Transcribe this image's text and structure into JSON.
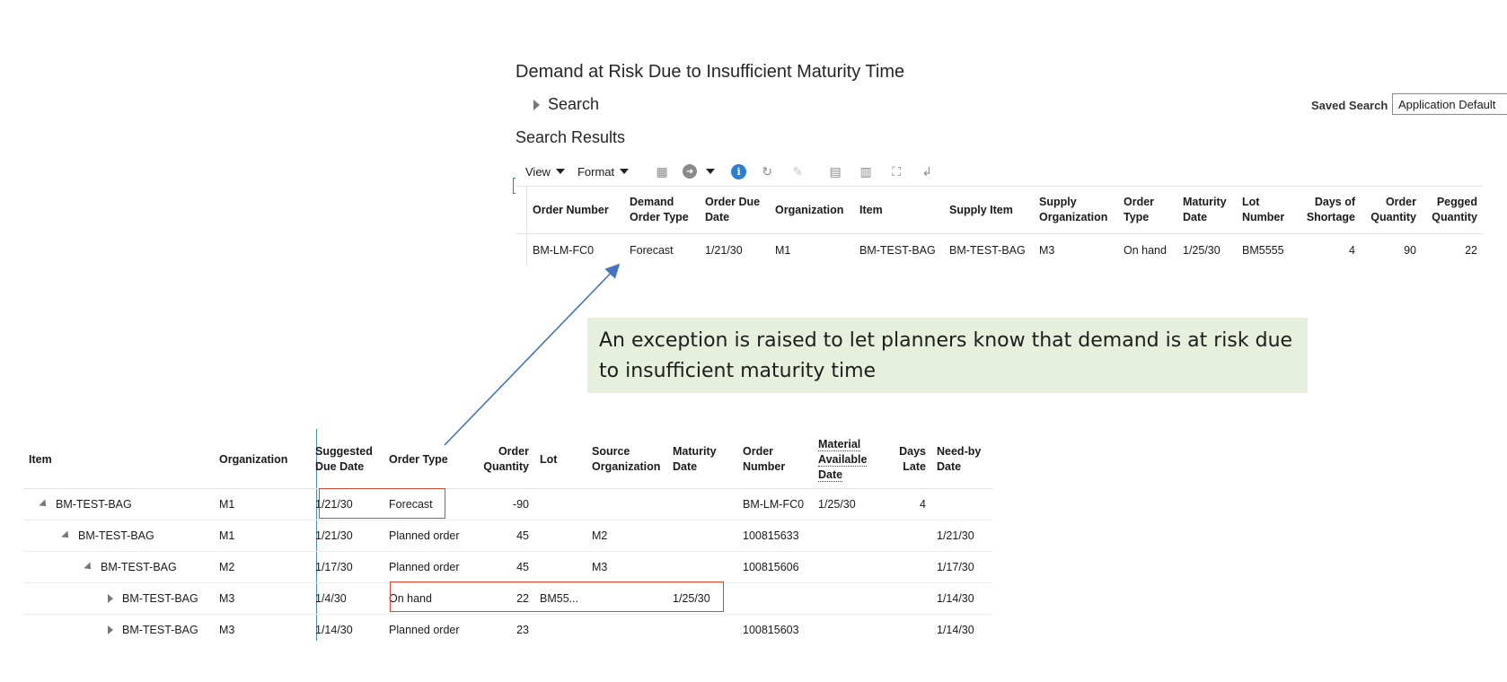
{
  "page": {
    "title": "Demand at Risk Due to Insufficient Maturity Time",
    "search_label": "Search",
    "saved_search_label": "Saved Search",
    "saved_search_value": "Application Default",
    "results_title": "Search Results"
  },
  "toolbar": {
    "view_label": "View",
    "format_label": "Format"
  },
  "results": {
    "headers": {
      "order_number": "Order Number",
      "demand_order_type_1": "Demand",
      "demand_order_type_2": "Order Type",
      "order_due_date_1": "Order Due",
      "order_due_date_2": "Date",
      "organization": "Organization",
      "item": "Item",
      "supply_item": "Supply Item",
      "supply_org_1": "Supply",
      "supply_org_2": "Organization",
      "order_type_1": "Order",
      "order_type_2": "Type",
      "maturity_date_1": "Maturity",
      "maturity_date_2": "Date",
      "lot_number_1": "Lot",
      "lot_number_2": "Number",
      "days_shortage_1": "Days of",
      "days_shortage_2": "Shortage",
      "order_qty_1": "Order",
      "order_qty_2": "Quantity",
      "pegged_qty_1": "Pegged",
      "pegged_qty_2": "Quantity"
    },
    "row": {
      "order_number": "BM-LM-FC0",
      "demand_order_type": "Forecast",
      "order_due_date": "1/21/30",
      "organization": "M1",
      "item": "BM-TEST-BAG",
      "supply_item": "BM-TEST-BAG",
      "supply_organization": "M3",
      "order_type": "On hand",
      "maturity_date": "1/25/30",
      "lot_number": "BM5555",
      "days_of_shortage": "4",
      "order_quantity": "90",
      "pegged_quantity": "22"
    }
  },
  "callout": {
    "text": "An exception is raised to let planners know that demand is at risk due to insufficient maturity time"
  },
  "plan": {
    "headers": {
      "item": "Item",
      "organization": "Organization",
      "suggested_due_1": "Suggested",
      "suggested_due_2": "Due Date",
      "order_type": "Order Type",
      "order_qty_1": "Order",
      "order_qty_2": "Quantity",
      "lot": "Lot",
      "source_org_1": "Source",
      "source_org_2": "Organization",
      "maturity_1": "Maturity",
      "maturity_2": "Date",
      "order_number_1": "Order",
      "order_number_2": "Number",
      "material_available_1": "Material",
      "material_available_2": "Available",
      "material_available_3": "Date",
      "days_late_1": "Days",
      "days_late_2": "Late",
      "need_by_1": "Need-by",
      "need_by_2": "Date"
    },
    "rows": [
      {
        "item": "BM-TEST-BAG",
        "organization": "M1",
        "suggested_due_date": "1/21/30",
        "order_type": "Forecast",
        "order_quantity": "-90",
        "lot": "",
        "source_organization": "",
        "maturity_date": "",
        "order_number": "BM-LM-FC0",
        "material_available_date": "1/25/30",
        "days_late": "4",
        "need_by_date": ""
      },
      {
        "item": "BM-TEST-BAG",
        "organization": "M1",
        "suggested_due_date": "1/21/30",
        "order_type": "Planned order",
        "order_quantity": "45",
        "lot": "",
        "source_organization": "M2",
        "maturity_date": "",
        "order_number": "100815633",
        "material_available_date": "",
        "days_late": "",
        "need_by_date": "1/21/30"
      },
      {
        "item": "BM-TEST-BAG",
        "organization": "M2",
        "suggested_due_date": "1/17/30",
        "order_type": "Planned order",
        "order_quantity": "45",
        "lot": "",
        "source_organization": "M3",
        "maturity_date": "",
        "order_number": "100815606",
        "material_available_date": "",
        "days_late": "",
        "need_by_date": "1/17/30"
      },
      {
        "item": "BM-TEST-BAG",
        "organization": "M3",
        "suggested_due_date": "1/4/30",
        "order_type": "On hand",
        "order_quantity": "22",
        "lot": "BM55...",
        "source_organization": "",
        "maturity_date": "1/25/30",
        "order_number": "",
        "material_available_date": "",
        "days_late": "",
        "need_by_date": "1/14/30"
      },
      {
        "item": "BM-TEST-BAG",
        "organization": "M3",
        "suggested_due_date": "1/14/30",
        "order_type": "Planned order",
        "order_quantity": "23",
        "lot": "",
        "source_organization": "",
        "maturity_date": "",
        "order_number": "100815603",
        "material_available_date": "",
        "days_late": "",
        "need_by_date": "1/14/30"
      }
    ]
  },
  "colors": {
    "highlight": "#d9482b",
    "callout_bg": "#e6f0dc",
    "arrow": "#4472c4",
    "info_icon": "#2a7fd1"
  },
  "icons": [
    "freeze-columns-icon",
    "go-arrow-icon",
    "info-icon",
    "refresh-icon",
    "edit-pencil-icon",
    "filter-icon",
    "columns-icon",
    "detach-icon",
    "wrap-icon"
  ]
}
